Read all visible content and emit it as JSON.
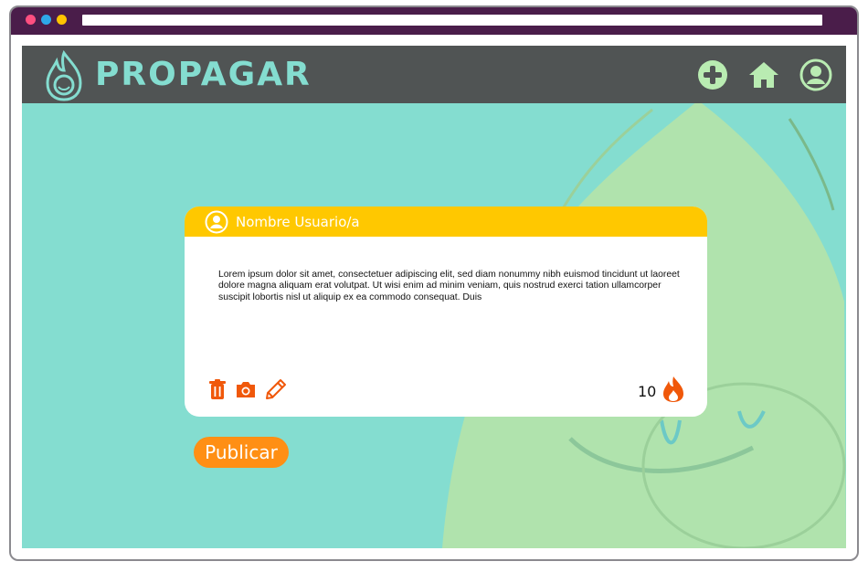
{
  "brand": {
    "name": "PROPAGAR"
  },
  "nav": {
    "add_icon": "plus-circle-icon",
    "home_icon": "home-icon",
    "profile_icon": "user-circle-icon"
  },
  "post": {
    "username": "Nombre Usuario/a",
    "text": "Lorem ipsum dolor sit amet, consectetuer adipiscing elit, sed diam nonummy nibh euismod tincidunt ut laoreet dolore magna aliquam erat volutpat. Ut wisi enim ad minim veniam, quis nostrud exerci tation ullamcorper suscipit lobortis nisl ut aliquip ex ea commodo consequat. Duis",
    "actions": [
      "trash-icon",
      "camera-icon",
      "pencil-icon"
    ],
    "flame_count": "10"
  },
  "publish_label": "Publicar",
  "colors": {
    "background": "#84ddd0",
    "navbar": "#505454",
    "card_header": "#ffc800",
    "accent": "#ff8f14",
    "icon_orange": "#f0580a",
    "window_frame": "#4a1d4a"
  }
}
